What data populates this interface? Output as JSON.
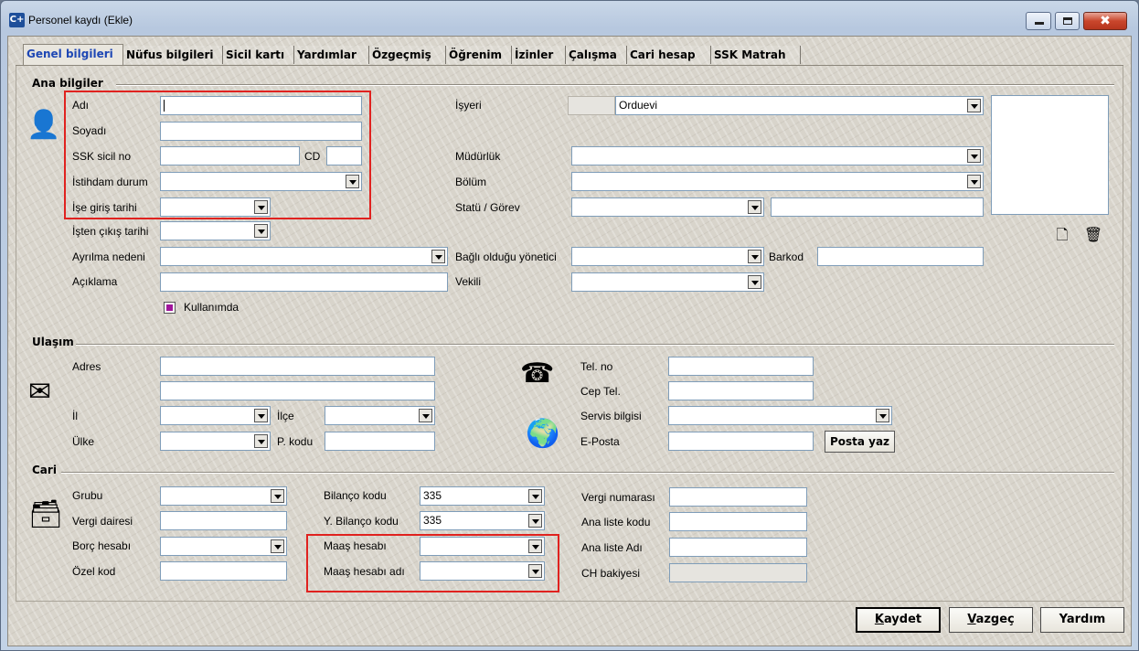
{
  "window": {
    "title": "Personel kaydı (Ekle)",
    "app_icon": "C+",
    "buttons": {
      "minimize": "minimize-icon",
      "maximize": "maximize-icon",
      "close": "✖"
    }
  },
  "tabs": [
    {
      "label": "Genel bilgileri",
      "active": true
    },
    {
      "label": "Nüfus bilgileri"
    },
    {
      "label": "Sicil kartı"
    },
    {
      "label": "Yardımlar"
    },
    {
      "label": "Özgeçmiş"
    },
    {
      "label": "Öğrenim"
    },
    {
      "label": "İzinler"
    },
    {
      "label": "Çalışma"
    },
    {
      "label": "Cari hesap"
    },
    {
      "label": "SSK Matrah"
    }
  ],
  "ana": {
    "section": "Ana bilgiler",
    "adi": "Adı",
    "soyadi": "Soyadı",
    "ssk_sicil": "SSK sicil no",
    "cd": "CD",
    "istihdam": "İstihdam durum",
    "ise_giris": "İşe giriş tarihi",
    "isten_cikis": "İşten çıkış tarihi",
    "ayrilma": "Ayrılma nedeni",
    "aciklama": "Açıklama",
    "kullanimda": "Kullanımda",
    "isyeri": "İşyeri",
    "isyeri_value": "Orduevi",
    "mudurluk": "Müdürlük",
    "bolum": "Bölüm",
    "statu": "Statü / Görev",
    "bagli": "Bağlı olduğu yönetici",
    "barkod": "Barkod",
    "vekili": "Vekili"
  },
  "ulasim": {
    "section": "Ulaşım",
    "adres": "Adres",
    "il": "İl",
    "ilce": "İlçe",
    "ulke": "Ülke",
    "pkodu": "P. kodu",
    "tel": "Tel. no",
    "cep": "Cep Tel.",
    "servis": "Servis bilgisi",
    "eposta": "E-Posta",
    "posta_yaz": "Posta yaz"
  },
  "cari": {
    "section": "Cari",
    "grubu": "Grubu",
    "vergi_dairesi": "Vergi dairesi",
    "borc": "Borç hesabı",
    "ozel": "Özel kod",
    "bilanco": "Bilanço kodu",
    "bilanco_value": "335",
    "y_bilanco": "Y. Bilanço kodu",
    "y_bilanco_value": "335",
    "maas": "Maaş hesabı",
    "maas_adi": "Maaş hesabı adı",
    "vergi_no": "Vergi numarası",
    "ana_liste_kodu": "Ana liste kodu",
    "ana_liste_adi": "Ana liste Adı",
    "ch_bakiyesi": "CH bakiyesi"
  },
  "footer": {
    "kaydet_first": "K",
    "kaydet_rest": "aydet",
    "vazgec_first": "V",
    "vazgec_rest": "azgeç",
    "yardim": "Yardım"
  },
  "icons": {
    "person": "👤",
    "mail": "✉",
    "phone": "☎",
    "globe": "🌍",
    "card_box": "🗃",
    "new_doc": "🗋",
    "trash": "🗑"
  },
  "colors": {
    "highlight": "#e0221f",
    "active_tab": "#1e47b4",
    "checkbox": "#a0169b"
  }
}
